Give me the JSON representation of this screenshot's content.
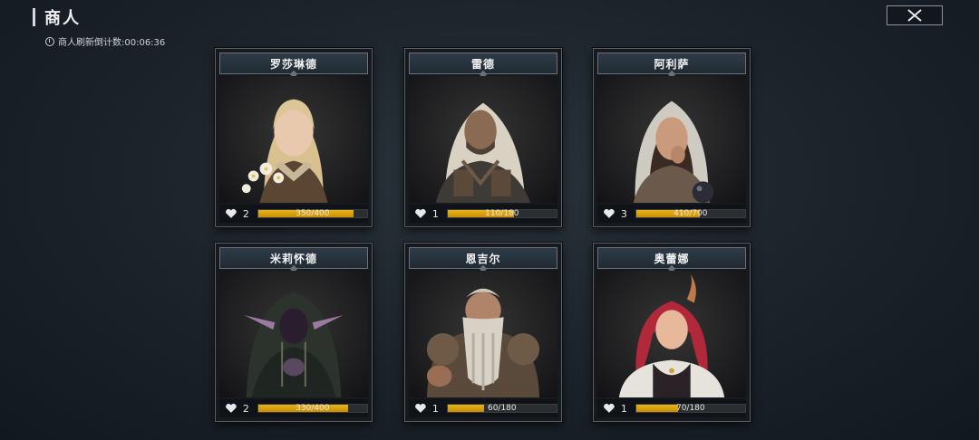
{
  "header": {
    "title": "商人",
    "refresh_text": "商人刷新倒计数:00:06:36"
  },
  "close_icon": "close-x-icon",
  "colors": {
    "progress": "#e0a611",
    "panel": "#161a1e",
    "background": "#1b2229"
  },
  "merchants": [
    {
      "name": "罗莎琳德",
      "affection": "2",
      "progress_text": "350/400",
      "progress": 0.875,
      "portrait": "blonde-woman-with-flowers"
    },
    {
      "name": "雷德",
      "affection": "1",
      "progress_text": "110/180",
      "progress": 0.611,
      "portrait": "hooded-man-armor"
    },
    {
      "name": "阿利萨",
      "affection": "3",
      "progress_text": "410/700",
      "progress": 0.586,
      "portrait": "hooded-woman-crystal-ball"
    },
    {
      "name": "米莉怀德",
      "affection": "2",
      "progress_text": "330/400",
      "progress": 0.825,
      "portrait": "hooded-elf-cloak"
    },
    {
      "name": "恩吉尔",
      "affection": "1",
      "progress_text": "60/180",
      "progress": 0.333,
      "portrait": "dwarf-braided-beard"
    },
    {
      "name": "奥蕾娜",
      "affection": "1",
      "progress_text": "70/180",
      "progress": 0.389,
      "portrait": "red-haired-woman-horns"
    }
  ]
}
